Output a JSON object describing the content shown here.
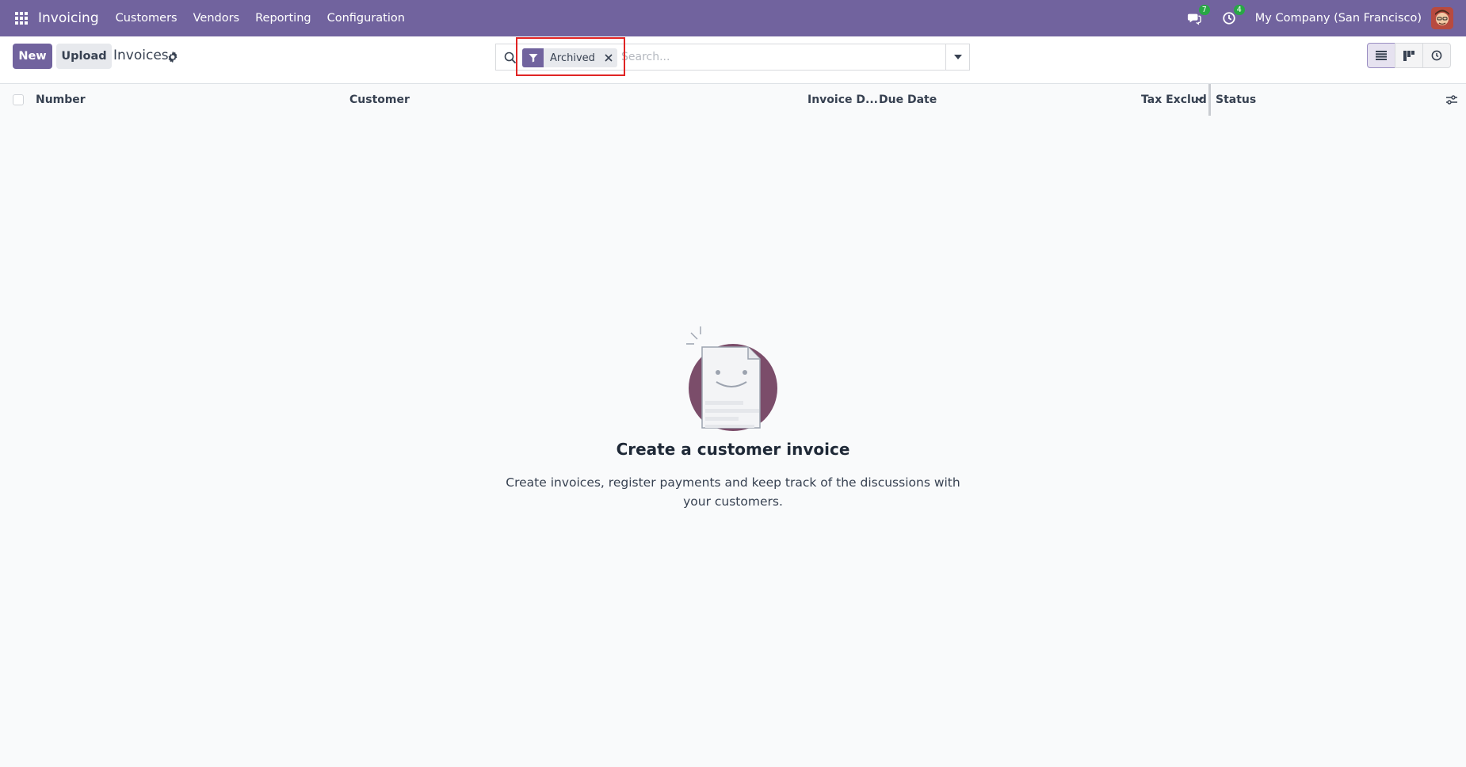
{
  "navbar": {
    "app_name": "Invoicing",
    "menu": [
      "Customers",
      "Vendors",
      "Reporting",
      "Configuration"
    ],
    "messages_count": "7",
    "activities_count": "4",
    "company": "My Company (San Francisco)",
    "color": "#71639e"
  },
  "control": {
    "new_label": "New",
    "upload_label": "Upload",
    "breadcrumb": "Invoices",
    "search": {
      "facet_label": "Archived",
      "placeholder": "Search..."
    },
    "views": [
      "list-view-icon",
      "kanban-view-icon",
      "activity-view-icon"
    ]
  },
  "list": {
    "columns": [
      "Number",
      "Customer",
      "Invoice D...",
      "Due Date",
      "Tax Exclud",
      "Status"
    ]
  },
  "empty_state": {
    "title": "Create a customer invoice",
    "text": "Create invoices, register payments and keep track of the discussions with your customers."
  }
}
